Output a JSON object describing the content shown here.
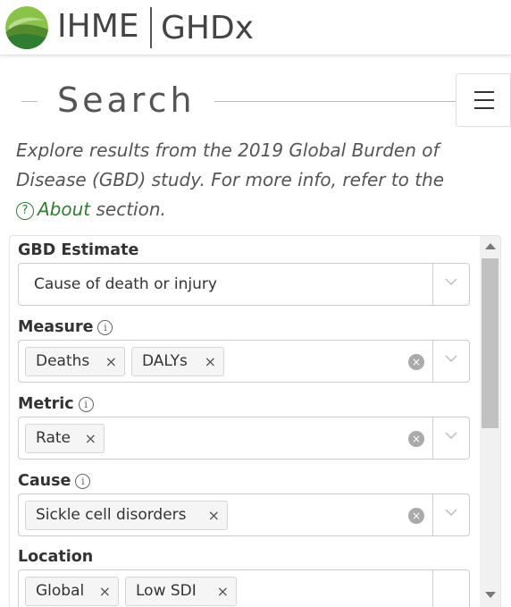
{
  "header": {
    "brand_left": "IHME",
    "brand_right": "GHDx",
    "logo_colors": [
      "#7cb342",
      "#2e7d32"
    ]
  },
  "search": {
    "title": "Search",
    "intro_line1": "Explore results from the 2019 Global Burden of",
    "intro_line2": "Disease (GBD) study. For more info, refer to the",
    "about_link": "About",
    "intro_tail": " section."
  },
  "menu": {
    "icon": "hamburger-menu-icon"
  },
  "fields": {
    "gbd_estimate": {
      "label": "GBD Estimate",
      "value": "Cause of death or injury"
    },
    "measure": {
      "label": "Measure",
      "tags": [
        "Deaths",
        "DALYs"
      ]
    },
    "metric": {
      "label": "Metric",
      "tags": [
        "Rate"
      ]
    },
    "cause": {
      "label": "Cause",
      "tags": [
        "Sickle cell disorders"
      ]
    },
    "location": {
      "label": "Location",
      "tags": [
        "Global",
        "Low SDI"
      ]
    }
  },
  "glyphs": {
    "remove": "×",
    "clear": "×",
    "info": "i",
    "help": "?"
  },
  "colors": {
    "accent_green": "#2e7d32",
    "text": "#333333"
  }
}
